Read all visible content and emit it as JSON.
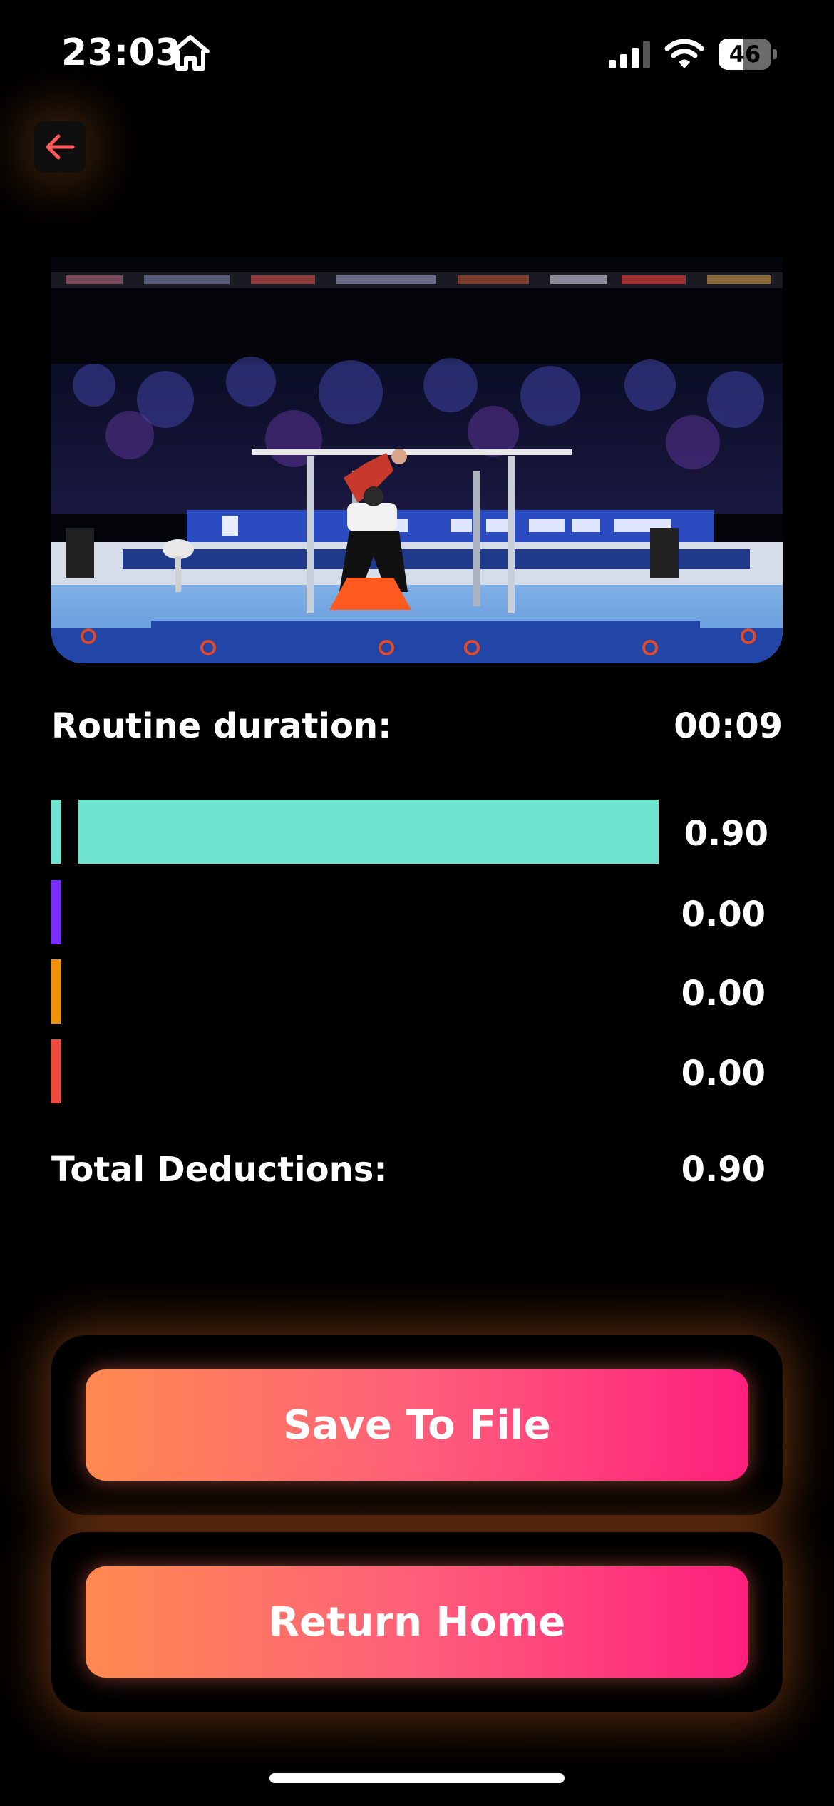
{
  "status_bar": {
    "time": "23:03",
    "battery_level": "46",
    "battery_fraction": 0.46,
    "icons": [
      "home-glyph-icon",
      "cellular-signal-icon",
      "wifi-icon",
      "battery-icon"
    ]
  },
  "navigation": {
    "back_icon": "arrow-left-icon",
    "back_color": "#ff5a5a"
  },
  "video": {
    "subject": "gymnastics-parallel-bars-video-frame"
  },
  "summary": {
    "duration_label": "Routine duration:",
    "duration_value": "00:09",
    "total_label": "Total Deductions:",
    "total_value": "0.90"
  },
  "deductions": [
    {
      "value": "0.90",
      "fraction": 1.0,
      "color": "#6ee3cf"
    },
    {
      "value": "0.00",
      "fraction": 0.0,
      "color": "#7b2cff"
    },
    {
      "value": "0.00",
      "fraction": 0.0,
      "color": "#f0900f"
    },
    {
      "value": "0.00",
      "fraction": 0.0,
      "color": "#ee4b3e"
    }
  ],
  "actions": {
    "save_label": "Save To File",
    "home_label": "Return Home"
  },
  "colors": {
    "background": "#000000",
    "button_gradient_start": "#ff8a50",
    "button_gradient_end": "#ff1f7e"
  }
}
